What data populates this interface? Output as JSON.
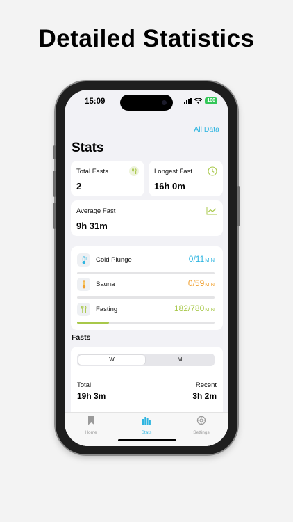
{
  "headline": "Detailed Statistics",
  "status": {
    "time": "15:09",
    "battery": "100"
  },
  "header": {
    "all_data": "All Data",
    "title": "Stats"
  },
  "cards": {
    "total_fasts": {
      "label": "Total Fasts",
      "value": "2",
      "icon": "fork-knife-icon"
    },
    "longest_fast": {
      "label": "Longest Fast",
      "value": "16h 0m",
      "icon": "clock-icon"
    },
    "average_fast": {
      "label": "Average Fast",
      "value": "9h 31m",
      "icon": "chart-line-icon"
    }
  },
  "activities": [
    {
      "name": "Cold Plunge",
      "count": "0/11",
      "unit": "MIN",
      "progress": 0,
      "color": "#2fb5e0",
      "icon": "thermometer-cold-icon"
    },
    {
      "name": "Sauna",
      "count": "0/59",
      "unit": "MIN",
      "progress": 0,
      "color": "#f0a030",
      "icon": "thermometer-hot-icon"
    },
    {
      "name": "Fasting",
      "count": "182/780",
      "unit": "MIN",
      "progress": 0.233,
      "color": "#a8c84a",
      "icon": "fork-knife-icon"
    }
  ],
  "fasts": {
    "section_title": "Fasts",
    "segments": [
      "W",
      "M"
    ],
    "selected_segment": "W",
    "total_label": "Total",
    "total_value": "19h 3m",
    "recent_label": "Recent",
    "recent_value": "3h 2m"
  },
  "tabs": [
    {
      "label": "Home",
      "icon": "bookmark-icon",
      "active": false
    },
    {
      "label": "Stats",
      "icon": "bar-chart-icon",
      "active": true
    },
    {
      "label": "Settings",
      "icon": "gear-icon",
      "active": false
    }
  ]
}
